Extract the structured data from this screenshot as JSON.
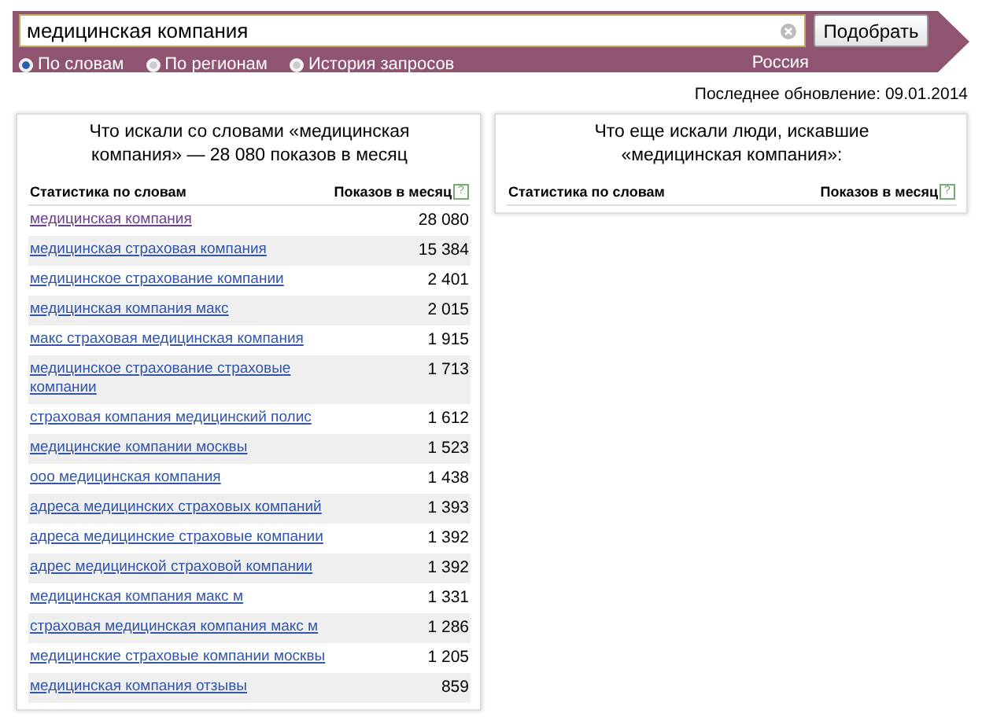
{
  "search": {
    "value": "медицинская компания",
    "button": "Подобрать"
  },
  "modes": [
    {
      "label": "По словам",
      "selected": true
    },
    {
      "label": "По регионам",
      "selected": false
    },
    {
      "label": "История запросов",
      "selected": false
    }
  ],
  "region": "Россия",
  "last_update": "Последнее обновление: 09.01.2014",
  "left_panel": {
    "title": "Что искали со словами «медицинская компания» — 28 080 показов в месяц",
    "columns": [
      "Статистика по словам",
      "Показов в месяц"
    ],
    "help": "?",
    "rows": [
      {
        "phrase": "медицинская компания",
        "count": "28 080",
        "visited": true
      },
      {
        "phrase": "медицинская страховая компания",
        "count": "15 384",
        "visited": false
      },
      {
        "phrase": "медицинское страхование компании",
        "count": "2 401",
        "visited": false
      },
      {
        "phrase": "медицинская компания макс",
        "count": "2 015",
        "visited": false
      },
      {
        "phrase": "макс страховая медицинская компания",
        "count": "1 915",
        "visited": false
      },
      {
        "phrase": "медицинское страхование страховые компании",
        "count": "1 713",
        "visited": false
      },
      {
        "phrase": "страховая компания медицинский полис",
        "count": "1 612",
        "visited": false
      },
      {
        "phrase": "медицинские компании москвы",
        "count": "1 523",
        "visited": false
      },
      {
        "phrase": "ооо медицинская компания",
        "count": "1 438",
        "visited": false
      },
      {
        "phrase": "адреса медицинских страховых компаний",
        "count": "1 393",
        "visited": false
      },
      {
        "phrase": "адреса медицинские страховые компании",
        "count": "1 392",
        "visited": false
      },
      {
        "phrase": "адрес медицинской страховой компании",
        "count": "1 392",
        "visited": false
      },
      {
        "phrase": "медицинская компания макс м",
        "count": "1 331",
        "visited": false
      },
      {
        "phrase": "страховая медицинская компания макс м",
        "count": "1 286",
        "visited": false
      },
      {
        "phrase": "медицинские страховые компании москвы",
        "count": "1 205",
        "visited": false
      },
      {
        "phrase": "медицинская компания отзывы",
        "count": "859",
        "visited": false
      }
    ]
  },
  "right_panel": {
    "title": "Что еще искали люди, искавшие «медицинская компания»:",
    "columns": [
      "Статистика по словам",
      "Показов в месяц"
    ],
    "help": "?"
  }
}
